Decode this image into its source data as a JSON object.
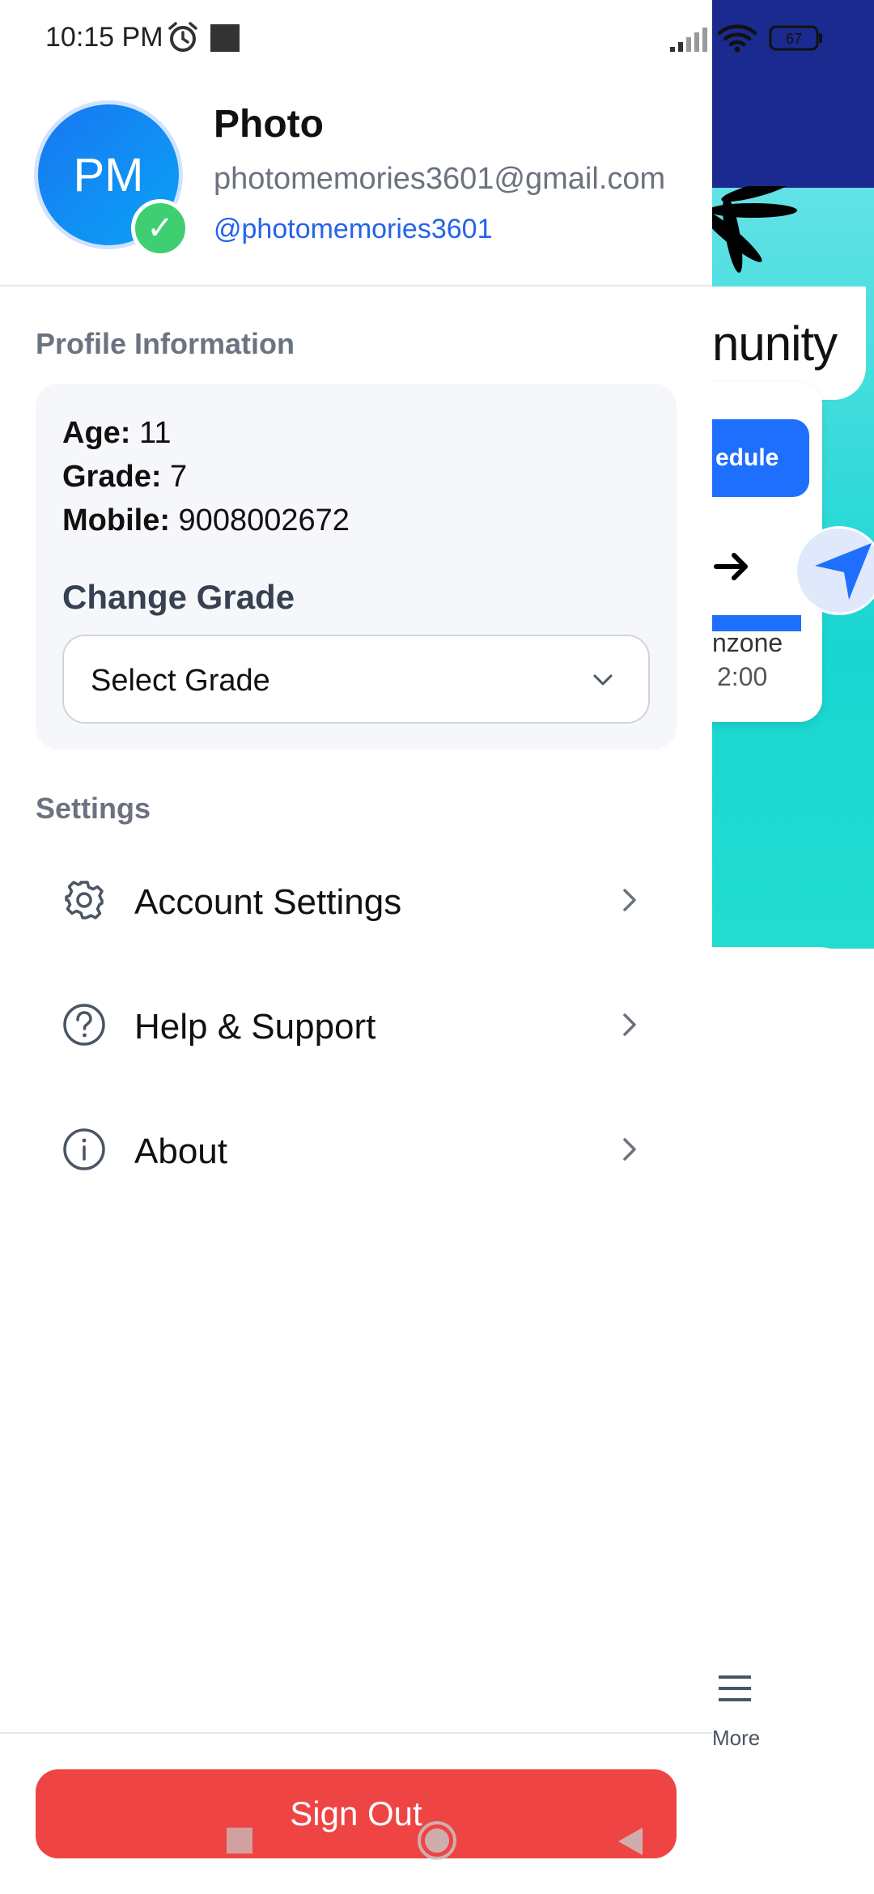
{
  "status_bar": {
    "time": "10:15 PM",
    "battery": "67"
  },
  "profile": {
    "initials": "PM",
    "name": "Photo",
    "email": "photomemories3601@gmail.com",
    "handle": "@photomemories3601",
    "verified_mark": "✓"
  },
  "profile_info": {
    "section_title": "Profile Information",
    "age_label": "Age:",
    "age_value": "11",
    "grade_label": "Grade:",
    "grade_value": "7",
    "mobile_label": "Mobile:",
    "mobile_value": "9008002672",
    "change_grade_title": "Change Grade",
    "grade_select_value": "Select Grade"
  },
  "settings": {
    "section_title": "Settings",
    "items": [
      {
        "label": "Account Settings",
        "icon": "gear-icon"
      },
      {
        "label": "Help & Support",
        "icon": "help-circle-icon"
      },
      {
        "label": "About",
        "icon": "info-icon"
      }
    ]
  },
  "footer": {
    "sign_out_label": "Sign Out"
  },
  "background_app": {
    "community_fragment": "nunity",
    "schedule_fragment": "edule",
    "zone_fragment": "nzone",
    "time_fragment": "2:00",
    "more_label": "More"
  },
  "colors": {
    "accent_blue": "#2563eb",
    "sign_out_red": "#ef4444",
    "verified_green": "#3fcf72",
    "header_navy": "#1a2a8f",
    "teal": "#19d6d2"
  }
}
